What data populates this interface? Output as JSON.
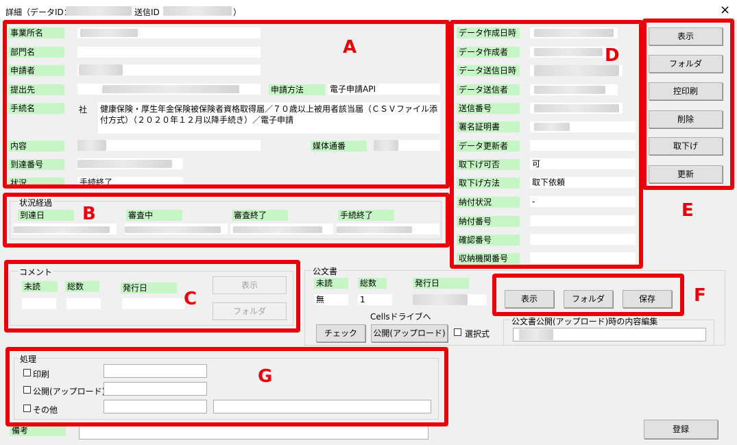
{
  "window": {
    "title_prefix": "詳細（データID：",
    "title_mid": "送信ID",
    "title_suffix": "）",
    "close": "×"
  },
  "sectionA": {
    "office": "事業所名",
    "dept": "部門名",
    "applicant": "申請者",
    "submit_to": "提出先",
    "method_label": "申請方法",
    "method_value": "電子申請API",
    "procedure_label": "手続名",
    "procedure_prefix": "社",
    "procedure_value": "健康保険・厚生年金保険被保険者資格取得届／７０歳以上被用者該当届（ＣＳＶファイル添付方式）（２０２０年１２月以降手続き）／電子申請",
    "content": "内容",
    "media_label": "媒体通番",
    "arrival_number": "到達番号",
    "status_label": "状況",
    "status_value": "手続終了"
  },
  "sectionB": {
    "title": "状況経過",
    "arrival": "到達日",
    "reviewing": "審査中",
    "reviewed": "審査終了",
    "done": "手続終了"
  },
  "sectionC": {
    "title": "コメント",
    "unread": "未読",
    "total": "総数",
    "issue_date": "発行日",
    "show": "表示",
    "folder": "フォルダ"
  },
  "sectionD": {
    "created_at": "データ作成日時",
    "creator": "データ作成者",
    "sent_at": "データ送信日時",
    "sender": "データ送信者",
    "send_no": "送信番号",
    "cert": "署名証明書",
    "updater": "データ更新者",
    "withdraw_ok": "取下げ可否",
    "withdraw_ok_value": "可",
    "withdraw_method": "取下げ方法",
    "withdraw_method_value": "取下依頼",
    "payment_status": "納付状況",
    "payment_status_value": "-",
    "payment_no": "納付番号",
    "confirm_no": "確認番号",
    "agency_no": "収納機関番号"
  },
  "sectionE": {
    "show": "表示",
    "folder": "フォルダ",
    "print": "控印刷",
    "delete": "削除",
    "withdraw": "取下げ",
    "update": "更新"
  },
  "official": {
    "title": "公文書",
    "unread": "未読",
    "total": "総数",
    "issue_date": "発行日",
    "unread_value": "無",
    "total_value": "1",
    "cells_drive": "Cellsドライブへ",
    "check": "チェック",
    "publish": "公開(アップロード)",
    "select": "選択式",
    "show": "表示",
    "folder": "フォルダ",
    "save": "保存",
    "edit_group": "公文書公開(アップロード)時の内容編集"
  },
  "process": {
    "title": "処理",
    "print": "印刷",
    "publish": "公開(アップロード)",
    "other": "その他"
  },
  "remarks": "備考",
  "register": "登録",
  "markers": {
    "A": "A",
    "B": "B",
    "C": "C",
    "D": "D",
    "E": "E",
    "F": "F",
    "G": "G"
  }
}
